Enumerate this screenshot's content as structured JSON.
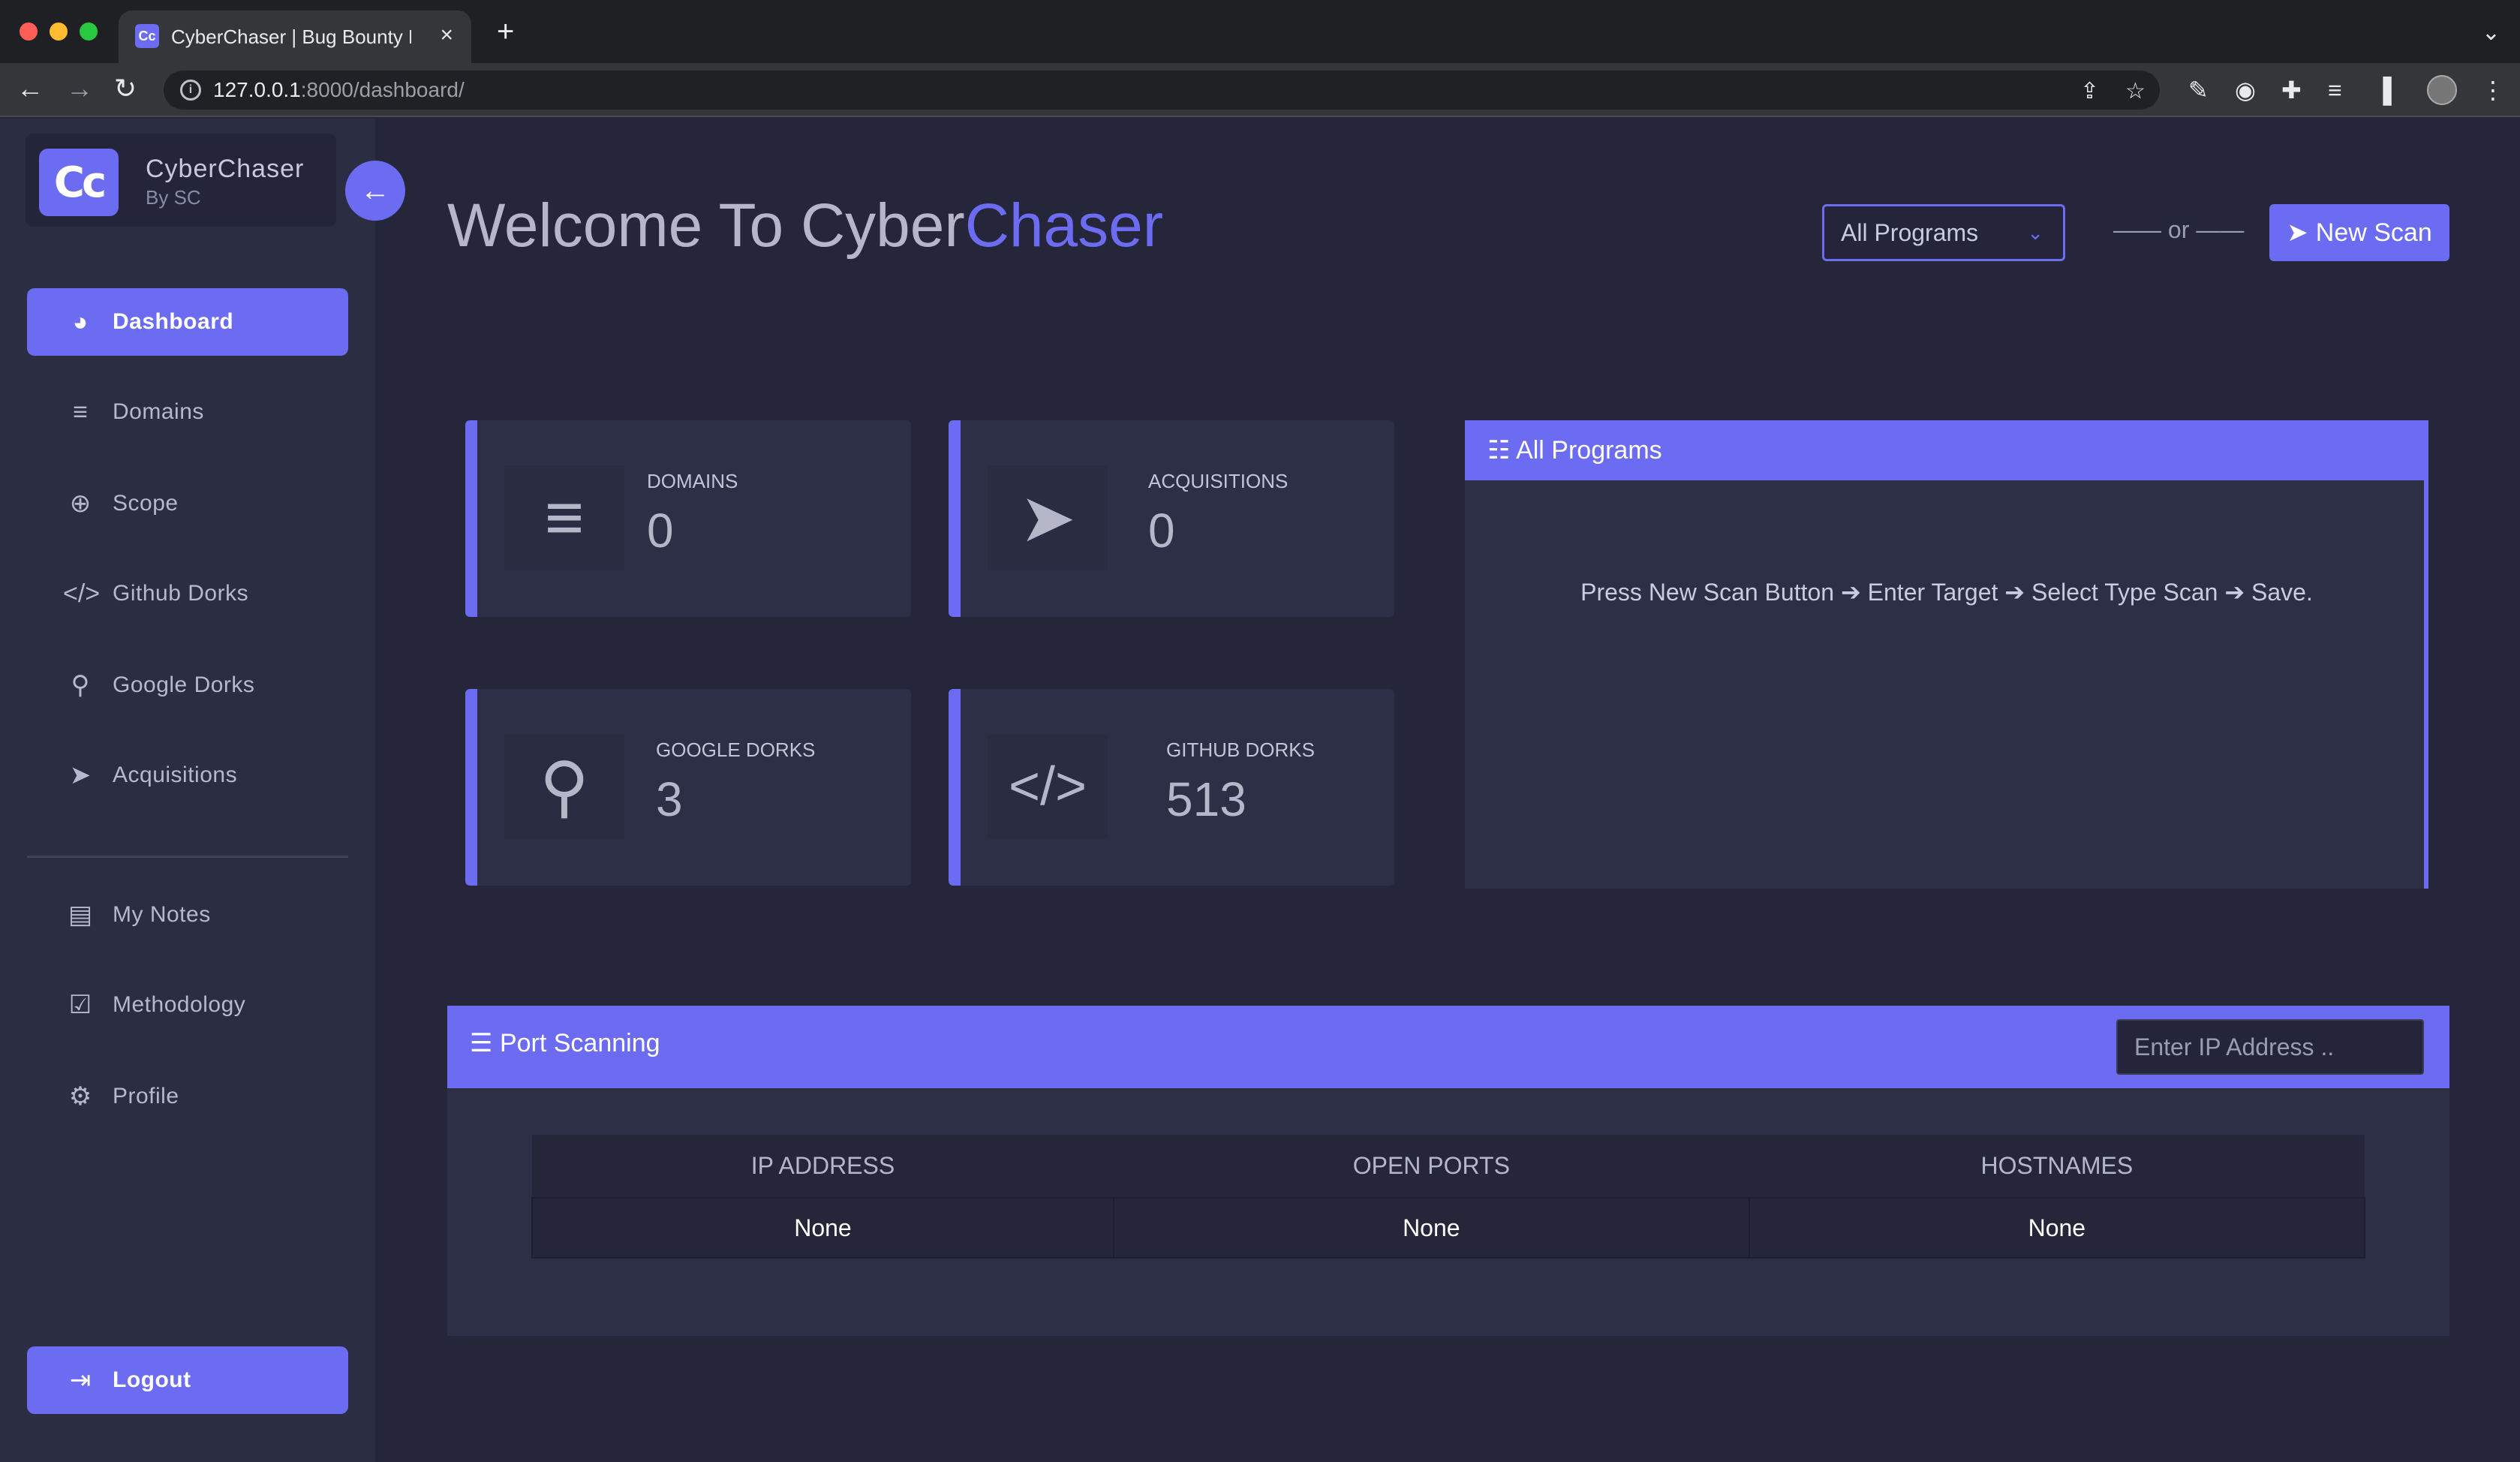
{
  "browser": {
    "tab_title": "CyberChaser | Bug Bounty Rec",
    "tab_favicon": "Cc",
    "url_host": "127.0.0.1",
    "url_rest": ":8000/dashboard/",
    "icons": [
      "back-icon",
      "forward-icon",
      "reload-icon",
      "share-icon",
      "star-icon",
      "extension-icon",
      "puzzle-icon",
      "media-icon",
      "sidepanel-icon",
      "menu-icon"
    ]
  },
  "sidebar": {
    "logo": "Cc",
    "brand_name": "CyberChaser",
    "brand_sub": "By SC",
    "items": [
      {
        "label": "Dashboard",
        "icon": "gauge-icon"
      },
      {
        "label": "Domains",
        "icon": "align-icon"
      },
      {
        "label": "Scope",
        "icon": "crosshair-icon"
      },
      {
        "label": "Github Dorks",
        "icon": "code-icon"
      },
      {
        "label": "Google Dorks",
        "icon": "search-icon"
      },
      {
        "label": "Acquisitions",
        "icon": "location-arrow-icon"
      },
      {
        "label": "My Notes",
        "icon": "note-icon"
      },
      {
        "label": "Methodology",
        "icon": "clipboard-check-icon"
      },
      {
        "label": "Profile",
        "icon": "gear-icon"
      }
    ],
    "logout_label": "Logout"
  },
  "header": {
    "welcome_prefix": "Welcome To Cyber",
    "welcome_accent": "Chaser",
    "program_select": "All Programs",
    "or_text": "—— or ——",
    "new_scan_label": "New Scan"
  },
  "stats": [
    {
      "label": "DOMAINS",
      "value": "0",
      "icon": "align-icon"
    },
    {
      "label": "ACQUISITIONS",
      "value": "0",
      "icon": "location-arrow-icon"
    },
    {
      "label": "GOOGLE DORKS",
      "value": "3",
      "icon": "search-icon"
    },
    {
      "label": "GITHUB DORKS",
      "value": "513",
      "icon": "code-icon"
    }
  ],
  "programs": {
    "title": "All Programs",
    "steps": [
      "Press New Scan Button",
      "Enter Target",
      "Select Type Scan",
      "Save."
    ]
  },
  "ports": {
    "title": "Port Scanning",
    "input_placeholder": "Enter IP Address ..",
    "columns": [
      "IP ADDRESS",
      "OPEN PORTS",
      "HOSTNAMES"
    ],
    "rows": [
      [
        "None",
        "None",
        "None"
      ]
    ]
  },
  "colors": {
    "accent": "#6c6cf2",
    "background": "#25263a",
    "card": "#2d2f46"
  }
}
